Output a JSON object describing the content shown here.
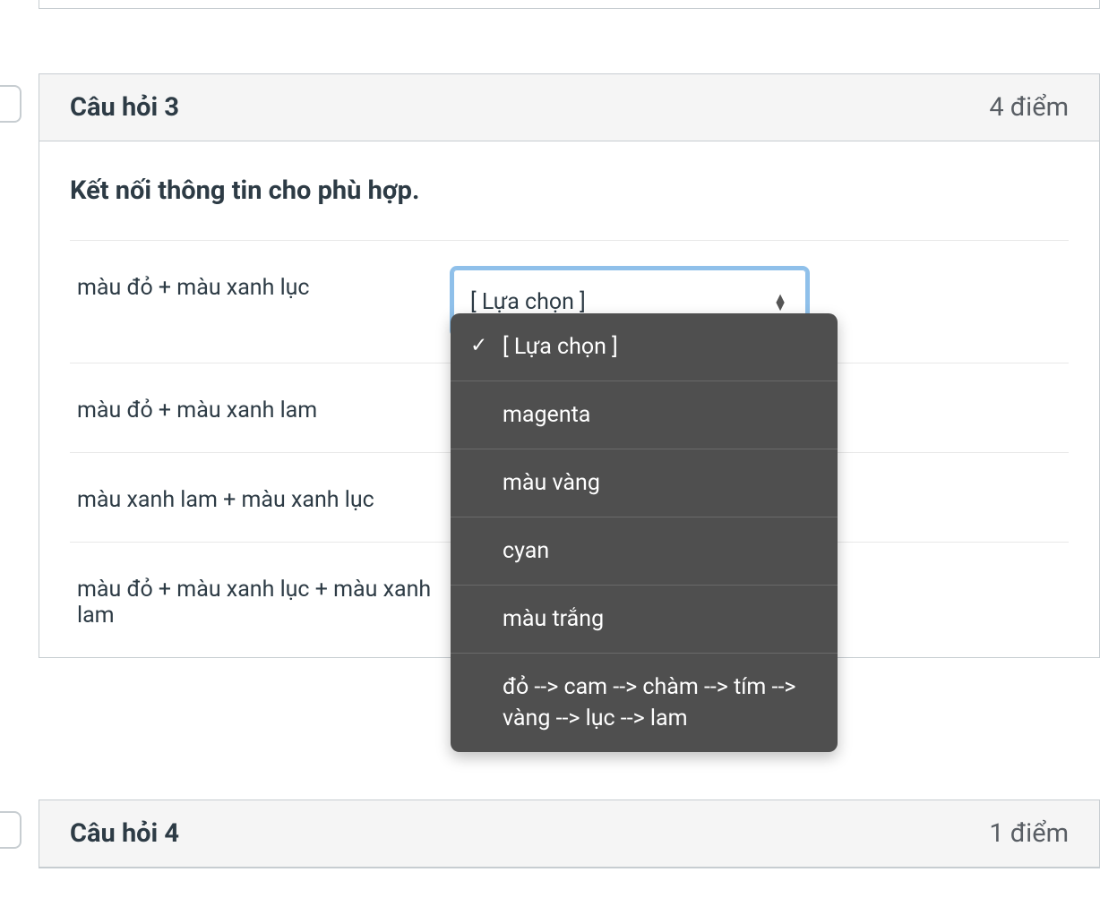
{
  "question3": {
    "title": "Câu hỏi 3",
    "points": "4 điểm",
    "prompt": "Kết nối thông tin cho phù hợp.",
    "rows": [
      {
        "label": "màu đỏ + màu xanh lục",
        "selected": "[ Lựa chọn ]"
      },
      {
        "label": "màu đỏ + màu xanh lam",
        "selected": ""
      },
      {
        "label": "màu xanh lam + màu xanh lục",
        "selected": ""
      },
      {
        "label": "màu đỏ + màu xanh lục + màu xanh lam",
        "selected": ""
      }
    ]
  },
  "dropdown": {
    "options": [
      "[ Lựa chọn ]",
      "magenta",
      "màu vàng",
      "cyan",
      "màu trắng",
      "đỏ --> cam --> chàm --> tím --> vàng --> lục --> lam"
    ],
    "selected_index": 0
  },
  "question4": {
    "title": "Câu hỏi 4",
    "points": "1 điểm"
  }
}
